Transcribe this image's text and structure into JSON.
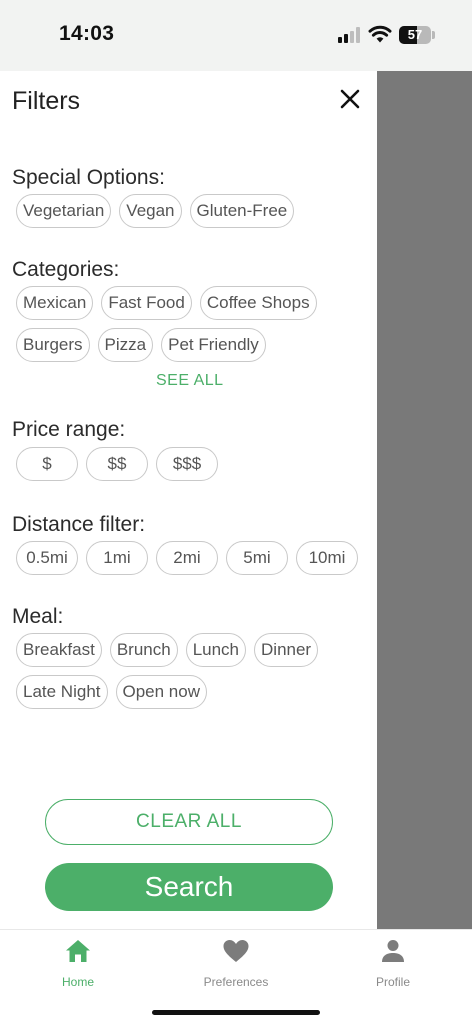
{
  "status_bar": {
    "time": "14:03",
    "battery": "57",
    "battery_level": 0.57
  },
  "filters": {
    "title": "Filters",
    "close_icon": "close-icon",
    "special_options": {
      "label": "Special Options:",
      "chips": [
        "Vegetarian",
        "Vegan",
        "Gluten-Free"
      ]
    },
    "categories": {
      "label": "Categories:",
      "chips_row1": [
        "Mexican",
        "Fast Food",
        "Coffee Shops"
      ],
      "chips_row2": [
        "Burgers",
        "Pizza",
        "Pet Friendly"
      ],
      "see_all": "SEE ALL"
    },
    "price_range": {
      "label": "Price range:",
      "chips": [
        "$",
        "$$",
        "$$$"
      ]
    },
    "distance": {
      "label": "Distance filter:",
      "chips": [
        "0.5mi",
        "1mi",
        "2mi",
        "5mi",
        "10mi"
      ]
    },
    "meal": {
      "label": "Meal:",
      "chips_row1": [
        "Breakfast",
        "Brunch",
        "Lunch",
        "Dinner"
      ],
      "chips_row2": [
        "Late Night",
        "Open now"
      ]
    },
    "clear_all": "CLEAR ALL",
    "search": "Search"
  },
  "tabbar": {
    "home": {
      "label": "Home",
      "icon": "home-icon"
    },
    "preferences": {
      "label": "Preferences",
      "icon": "heart-icon"
    },
    "profile": {
      "label": "Profile",
      "icon": "person-icon"
    }
  },
  "colors": {
    "accent": "#4caf69",
    "overlay": "#797979",
    "chip_border": "#c9c9c9"
  }
}
